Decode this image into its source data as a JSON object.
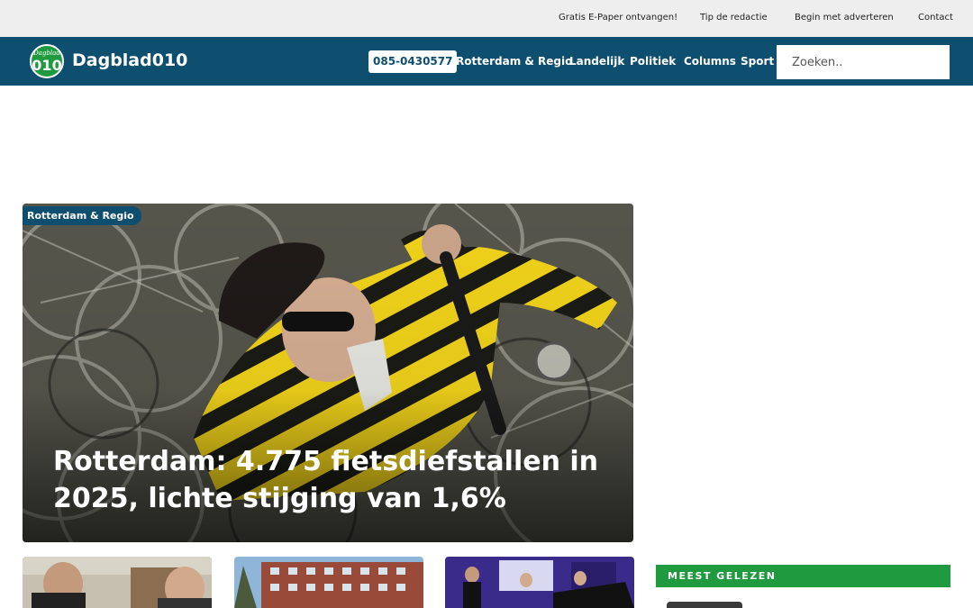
{
  "topbar": {
    "links": [
      "Gratis E-Paper ontvangen!",
      "Tip de redactie",
      "Begin met adverteren",
      "Contact"
    ]
  },
  "header": {
    "logo_small": "Dagblad",
    "logo_big": "010",
    "brand": "Dagblad010",
    "phone": "085-0430577",
    "nav": [
      "Rotterdam & Regio",
      "Landelijk",
      "Politiek",
      "Columns",
      "Sport"
    ],
    "search_placeholder": "Zoeken.."
  },
  "hero": {
    "category": "Rotterdam & Regio",
    "title": "Rotterdam: 4.775 fietsdiefstallen in 2025, lichte stijging van 1,6%"
  },
  "sidebar": {
    "most_read_label": "MEEST GELEZEN"
  },
  "colors": {
    "nav_bg": "#0e4e6e",
    "accent_green": "#1f9a3f",
    "topbar_bg": "#eeeeee"
  }
}
